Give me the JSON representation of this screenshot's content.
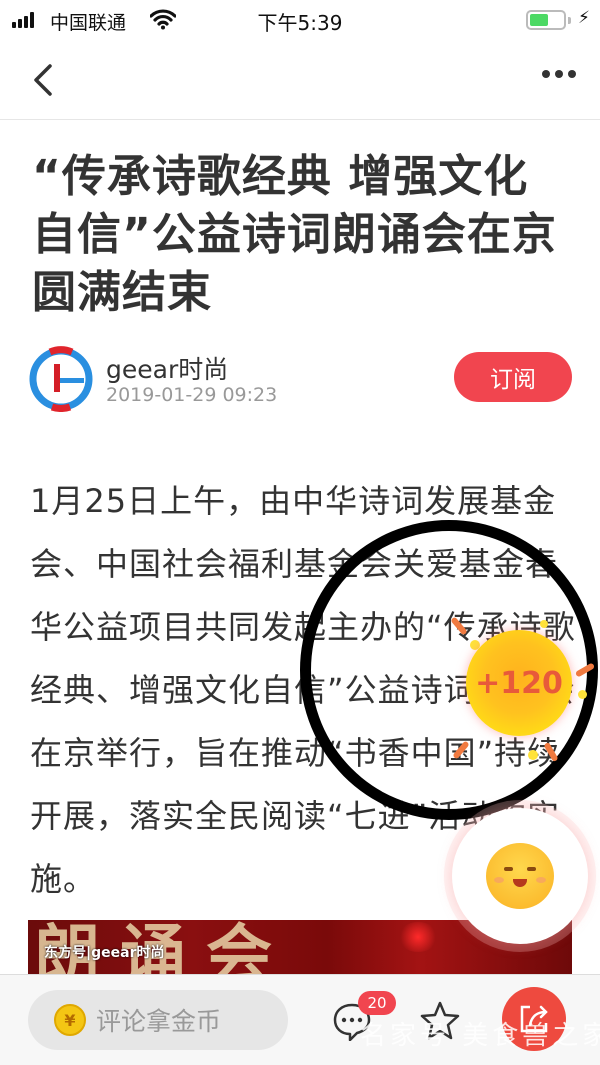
{
  "status_bar": {
    "carrier": "中国联通",
    "time": "下午5:39",
    "battery_level": 0.55,
    "icons": [
      "signal-icon",
      "wifi-icon",
      "battery-icon",
      "charging-bolt-icon"
    ]
  },
  "navbar": {
    "back_icon": "chevron-left-icon",
    "more_icon": "more-dots-icon"
  },
  "article": {
    "title": "“传承诗歌经典 增强文化自信”公益诗词朗诵会在京圆满结束",
    "author": {
      "name": "geear时尚",
      "date": "2019-01-29 09:23",
      "avatar_icon": "geear-logo-icon"
    },
    "subscribe_label": "订阅",
    "body": "1月25日上午，由中华诗词发展基金会、中国社会福利基金会关爱基金春华公益项目共同发起主办的“传承诗歌经典、增强文化自信”公益诗词朗诵会在京举行，旨在推动“书香中国”持续开展，落实全民阅读“七进”活动的实施。",
    "image": {
      "big_text": "朗诵会",
      "caption": "东方号|geear时尚"
    }
  },
  "reward": {
    "coin_text": "+120"
  },
  "bottom_bar": {
    "comment_placeholder": "评论拿金币",
    "coin_symbol": "¥",
    "comment_count": "20",
    "icons": [
      "comment-icon",
      "star-icon",
      "share-icon"
    ],
    "watermark": "名家号 美食兽之家"
  },
  "colors": {
    "accent_red": "#f1454f",
    "battery_green": "#4cd964",
    "coin_yellow": "#ffc21f"
  }
}
